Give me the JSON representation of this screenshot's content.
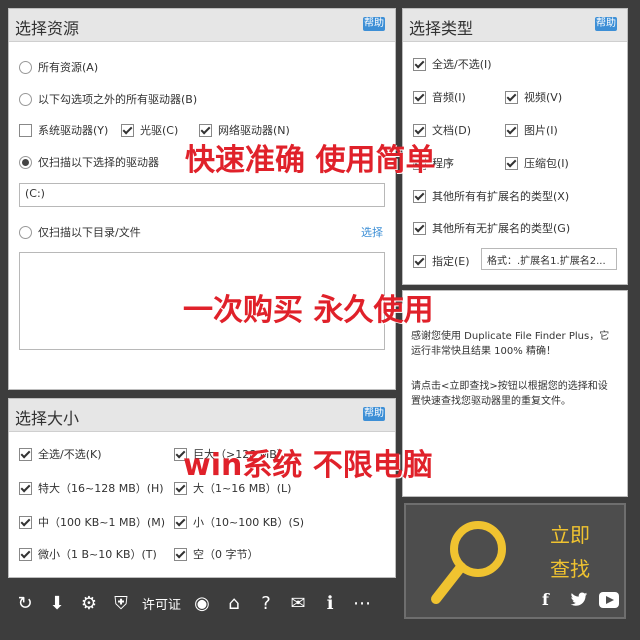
{
  "overlays": {
    "line1": "快速准确  使用简单",
    "line2": "一次购买  永久使用",
    "line3": "win系统  不限电脑"
  },
  "resources": {
    "title": "选择资源",
    "help": "帮助",
    "all_resources": "所有资源(A)",
    "all_except": "以下勾选项之外的所有驱动器(B)",
    "sys_drive": "系统驱动器(Y)",
    "optical": "光驱(C)",
    "network": "网络驱动器(N)",
    "only_selected": "仅扫描以下选择的驱动器",
    "drive_value": "(C:)",
    "only_dirs": "仅扫描以下目录/文件",
    "select_link": "选择"
  },
  "types": {
    "title": "选择类型",
    "help": "帮助",
    "select_all": "全选/不选(I)",
    "audio": "音频(I)",
    "video": "视频(V)",
    "document": "文档(D)",
    "image": "图片(I)",
    "program": "程序",
    "archive": "压缩包(I)",
    "other_ext": "其他所有有扩展名的类型(X)",
    "no_ext": "其他所有无扩展名的类型(G)",
    "specify": "指定(E)",
    "format_placeholder": "格式：.扩展名1.扩展名2..."
  },
  "info": {
    "text1": "感谢您使用 Duplicate File Finder Plus，它运行非常快且结果 100% 精确！",
    "text2": "请点击<立即查找>按钮以根据您的选择和设置快速查找您驱动器里的重复文件。"
  },
  "size": {
    "title": "选择大小",
    "help": "帮助",
    "select_all": "全选/不选(K)",
    "huge": "巨大（>128 MB）",
    "very_large": "特大（16~128 MB）(H)",
    "large": "大（1~16 MB）(L)",
    "medium": "中（100 KB~1 MB）(M)",
    "small": "小（10~100 KB）(S)",
    "tiny": "微小（1 B~10 KB）(T)",
    "empty": "空（0 字节）"
  },
  "toolbar": {
    "license": "许可证"
  },
  "find": {
    "line1": "立即",
    "line2": "查找"
  },
  "colors": {
    "accent": "#3d8fd6",
    "overlay": "#e0212a",
    "find": "#f0c330"
  }
}
